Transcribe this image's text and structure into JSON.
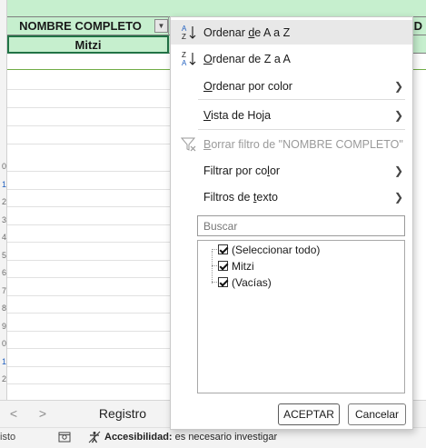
{
  "sheet": {
    "header_col1": "NOMBRE COMPLETO",
    "header_col2_fragment": "AD",
    "data_value": "Mitzi",
    "row_numbers": [
      {
        "label": "0",
        "selected": false
      },
      {
        "label": "1",
        "selected": true
      },
      {
        "label": "2",
        "selected": false
      },
      {
        "label": "3",
        "selected": false
      },
      {
        "label": "4",
        "selected": false
      },
      {
        "label": "5",
        "selected": false
      },
      {
        "label": "6",
        "selected": false
      },
      {
        "label": "7",
        "selected": false
      },
      {
        "label": "8",
        "selected": false
      },
      {
        "label": "9",
        "selected": false
      },
      {
        "label": "0",
        "selected": false
      },
      {
        "label": "1",
        "selected": true
      },
      {
        "label": "2",
        "selected": false
      }
    ]
  },
  "tabs": {
    "prev_arrow": "<",
    "next_arrow": ">",
    "sheet_tab": "Registro"
  },
  "status": {
    "left_text": "isto",
    "accessibility_label": "Accesibilidad:",
    "accessibility_value": "es necesario investigar"
  },
  "menu": {
    "sort_az_pre": "Ordenar ",
    "sort_az_u": "d",
    "sort_az_post": "e A a Z",
    "sort_za_pre": "",
    "sort_za_u": "O",
    "sort_za_post": "rdenar de Z a A",
    "sort_color_pre": "",
    "sort_color_u": "O",
    "sort_color_post": "rdenar por color",
    "sheet_view_pre": "",
    "sheet_view_u": "V",
    "sheet_view_post": "ista de Hoja",
    "clear_filter_pre": "",
    "clear_filter_u": "B",
    "clear_filter_post": "orrar filtro de \"NOMBRE COMPLETO\"",
    "filter_color_pre": "Filtrar por co",
    "filter_color_u": "l",
    "filter_color_post": "or",
    "text_filters_pre": "Filtros de ",
    "text_filters_u": "t",
    "text_filters_post": "exto",
    "search_placeholder": "Buscar",
    "checklist": [
      {
        "label": "(Seleccionar todo)",
        "checked": true
      },
      {
        "label": "Mitzi",
        "checked": true
      },
      {
        "label": "(Vacías)",
        "checked": true
      }
    ],
    "ok_label": "ACEPTAR",
    "cancel_label": "Cancelar"
  },
  "colors": {
    "table_header": "#c6efce",
    "selection_border": "#217346",
    "menu_hover": "#e8e8e8",
    "disabled_text": "#9a9a9a"
  }
}
